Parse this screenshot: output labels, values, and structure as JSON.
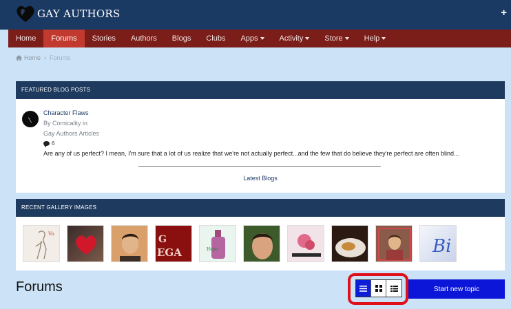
{
  "header": {
    "logo_text": "GAY AUTHORS",
    "plus_label": "+"
  },
  "nav": {
    "items": [
      {
        "label": "Home",
        "active": false,
        "dropdown": false
      },
      {
        "label": "Forums",
        "active": true,
        "dropdown": false
      },
      {
        "label": "Stories",
        "active": false,
        "dropdown": false
      },
      {
        "label": "Authors",
        "active": false,
        "dropdown": false
      },
      {
        "label": "Blogs",
        "active": false,
        "dropdown": false
      },
      {
        "label": "Clubs",
        "active": false,
        "dropdown": false
      },
      {
        "label": "Apps",
        "active": false,
        "dropdown": true
      },
      {
        "label": "Activity",
        "active": false,
        "dropdown": true
      },
      {
        "label": "Store",
        "active": false,
        "dropdown": true
      },
      {
        "label": "Help",
        "active": false,
        "dropdown": true
      }
    ]
  },
  "breadcrumb": {
    "home": "Home",
    "separator": "›",
    "current": "Forums"
  },
  "featured": {
    "heading": "FEATURED BLOG POSTS",
    "post_title": "Character Flaws",
    "post_by": "By Comicality in",
    "post_category": "Gay Authors Articles",
    "comment_count": "6",
    "excerpt": "Are any of us perfect? I mean, I'm sure that a lot of us realize that we're not actually perfect...and the few that do believe they're perfect are often blind...",
    "latest_link": "Latest Blogs"
  },
  "gallery": {
    "heading": "RECENT GALLERY IMAGES",
    "thumbnails": [
      "sketch-figure",
      "red-heart",
      "portrait-man",
      "ega-sign",
      "bottle",
      "face-closeup",
      "pink-flowers",
      "food-plate",
      "portrait-boy",
      "blue-text"
    ],
    "thumb_text_last": "Bi"
  },
  "forums": {
    "title": "Forums",
    "start_topic": "Start new topic",
    "view_modes": [
      "list",
      "grid",
      "condensed"
    ],
    "active_view": "list"
  },
  "colors": {
    "header_bg": "#1b3a63",
    "nav_bg": "#7b1e1a",
    "nav_active": "#c23a2f",
    "page_bg": "#cce3f7",
    "button_blue": "#0b16d8",
    "highlight_red": "#e0101a"
  }
}
